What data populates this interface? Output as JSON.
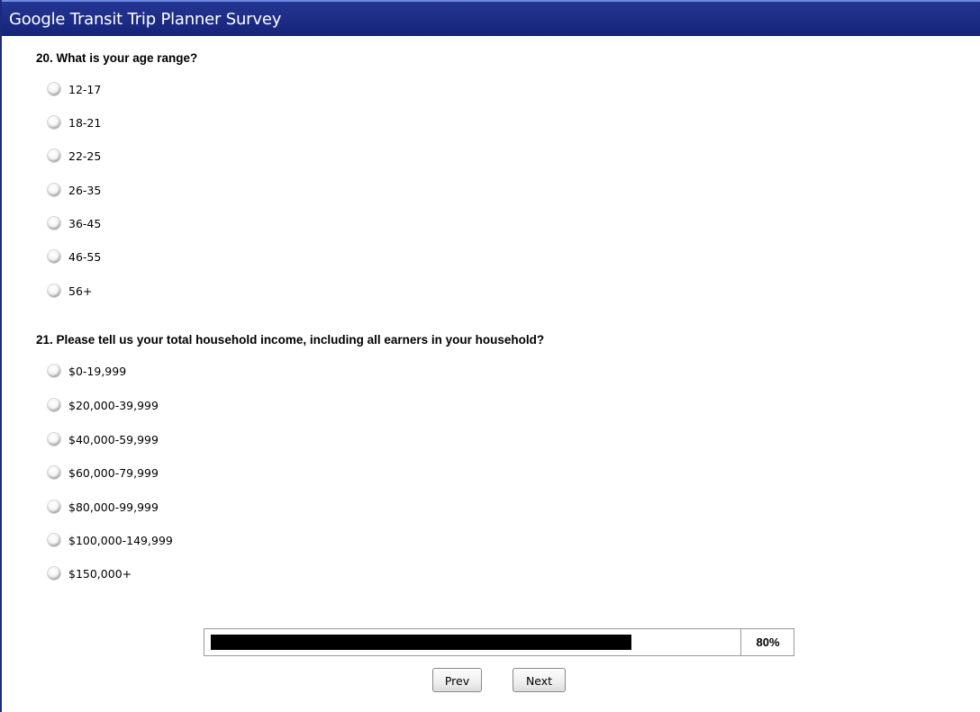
{
  "window": {
    "title": "Google Transit Trip Planner Survey"
  },
  "questions": [
    {
      "label": "20. What is your age range?",
      "options": [
        "12-17",
        "18-21",
        "22-25",
        "26-35",
        "36-45",
        "46-55",
        "56+"
      ]
    },
    {
      "label": "21. Please tell us your total household income, including all earners in your household?",
      "options": [
        "$0-19,999",
        "$20,000-39,999",
        "$40,000-59,999",
        "$60,000-79,999",
        "$80,000-99,999",
        "$100,000-149,999",
        "$150,000+"
      ]
    }
  ],
  "progress": {
    "value": 0.8,
    "label": "80%"
  },
  "nav": {
    "prev_label": "Prev",
    "next_label": "Next"
  },
  "colors": {
    "title_bar": "#1c2a84",
    "progress_fill": "#000000"
  },
  "icons": {
    "radio": "radio-button-icon"
  }
}
